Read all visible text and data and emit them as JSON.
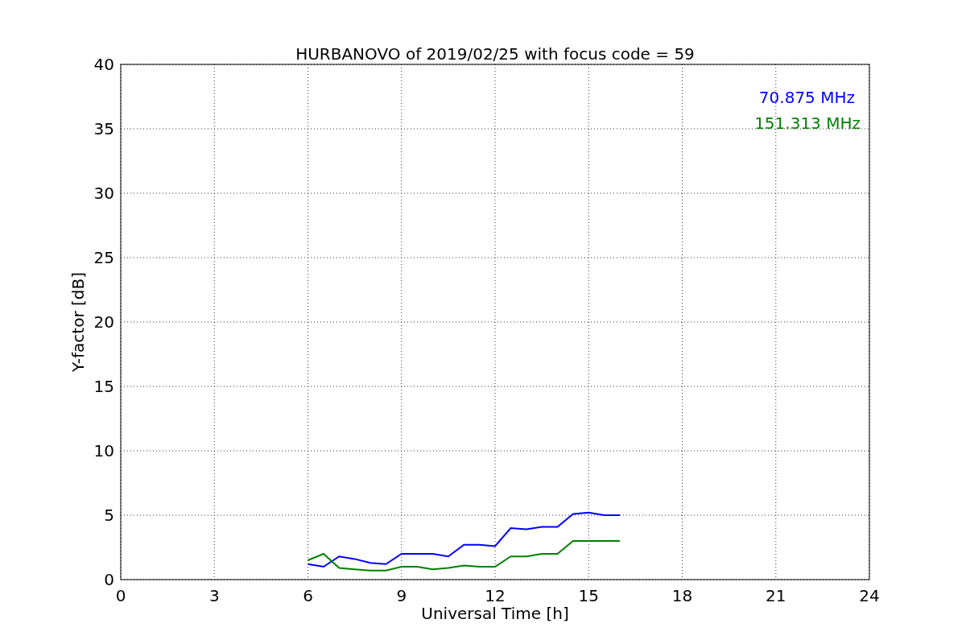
{
  "chart_data": {
    "type": "line",
    "title": "HURBANOVO of 2019/02/25 with focus code = 59",
    "xlabel": "Universal Time [h]",
    "ylabel": "Y-factor [dB]",
    "x": [
      6,
      6.5,
      7,
      7.5,
      8,
      8.5,
      9,
      9.5,
      10,
      10.5,
      11,
      11.5,
      12,
      12.5,
      13,
      13.5,
      14,
      14.5,
      15,
      15.5,
      16
    ],
    "series": [
      {
        "name": "70.875 MHz",
        "color": "#0000ff",
        "values": [
          1.2,
          1.0,
          1.8,
          1.6,
          1.3,
          1.2,
          2.0,
          2.0,
          2.0,
          1.8,
          2.7,
          2.7,
          2.6,
          4.0,
          3.9,
          4.1,
          4.1,
          5.1,
          5.2,
          5.0,
          5.0
        ]
      },
      {
        "name": "151.313 MHz",
        "color": "#008000",
        "values": [
          1.5,
          2.0,
          0.9,
          0.8,
          0.7,
          0.7,
          1.0,
          1.0,
          0.8,
          0.9,
          1.1,
          1.0,
          1.0,
          1.8,
          1.8,
          2.0,
          2.0,
          3.0,
          3.0,
          3.0,
          3.0
        ]
      }
    ],
    "xlim": [
      0,
      24
    ],
    "ylim": [
      0,
      40
    ],
    "xticks": [
      0,
      3,
      6,
      9,
      12,
      15,
      18,
      21,
      24
    ],
    "yticks": [
      0,
      5,
      10,
      15,
      20,
      25,
      30,
      35,
      40
    ],
    "grid": true
  }
}
